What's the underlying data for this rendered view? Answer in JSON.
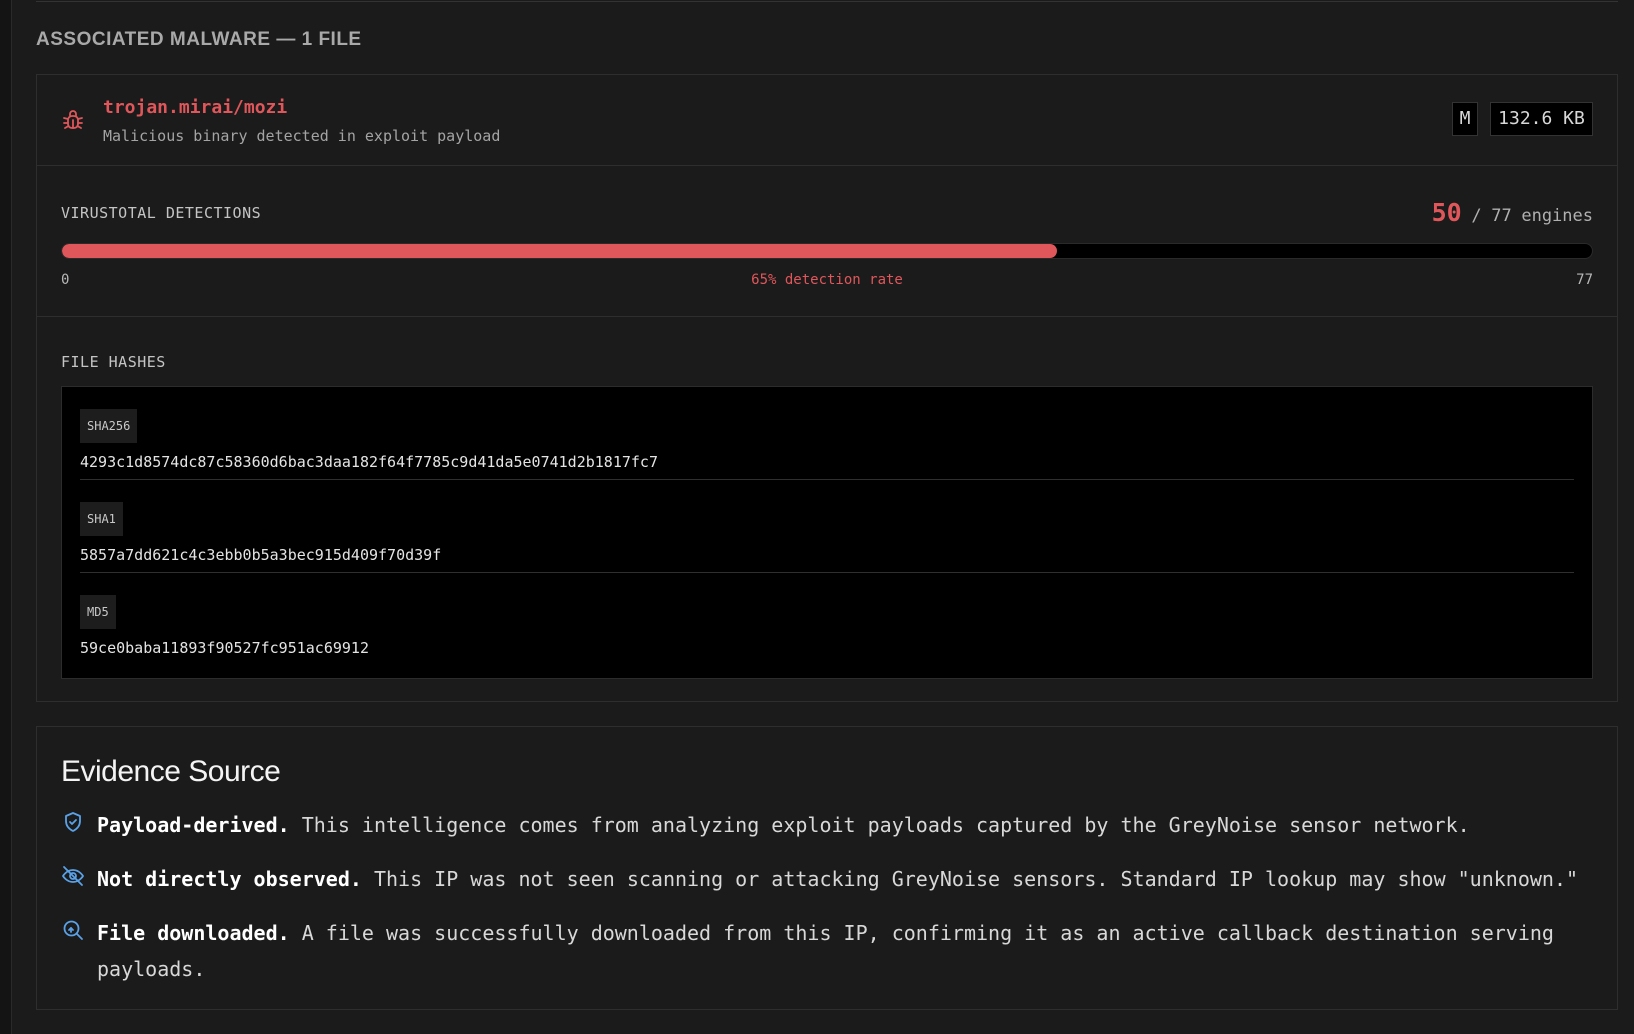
{
  "malware_section": {
    "heading": "ASSOCIATED MALWARE — 1 FILE",
    "file": {
      "name": "trojan.mirai/mozi",
      "description": "Malicious binary detected in exploit payload",
      "type_badge": "M",
      "size": "132.6 KB",
      "icon": "bug-icon"
    },
    "virustotal": {
      "label": "VIRUSTOTAL DETECTIONS",
      "detected": "50",
      "separator": "/",
      "total": "77",
      "unit": "engines",
      "detection_fraction": 0.65,
      "scale_min": "0",
      "scale_max": "77",
      "rate_text": "65% detection rate"
    },
    "hashes": {
      "label": "FILE HASHES",
      "rows": [
        {
          "algo": "SHA256",
          "value": "4293c1d8574dc87c58360d6bac3daa182f64f7785c9d41da5e0741d2b1817fc7"
        },
        {
          "algo": "SHA1",
          "value": "5857a7dd621c4c3ebb0b5a3bec915d409f70d39f"
        },
        {
          "algo": "MD5",
          "value": "59ce0baba11893f90527fc951ac69912"
        }
      ]
    }
  },
  "evidence": {
    "title": "Evidence Source",
    "items": [
      {
        "icon": "shield-check-icon",
        "bold": "Payload-derived.",
        "text": "This intelligence comes from analyzing exploit payloads captured by the GreyNoise sensor network."
      },
      {
        "icon": "eye-off-icon",
        "bold": "Not directly observed.",
        "text": "This IP was not seen scanning or attacking GreyNoise sensors. Standard IP lookup may show \"unknown.\""
      },
      {
        "icon": "file-search-icon",
        "bold": "File downloaded.",
        "text": "A file was successfully downloaded from this IP, confirming it as an active callback destination serving payloads."
      }
    ]
  },
  "colors": {
    "accent_red": "#e0575b",
    "info_blue": "#5aa2e8",
    "background": "#1b1b1b"
  }
}
